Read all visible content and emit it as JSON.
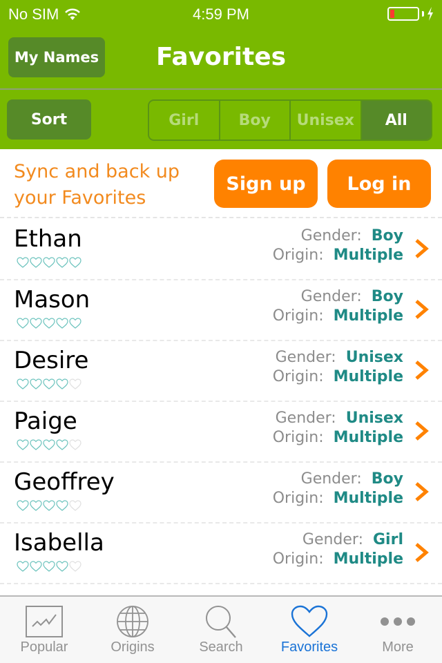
{
  "status_bar": {
    "carrier": "No SIM",
    "time": "4:59 PM",
    "battery_level": 0.1,
    "charging": true
  },
  "nav": {
    "title": "Favorites",
    "my_names_label": "My Names"
  },
  "filter": {
    "sort_label": "Sort",
    "segments": [
      {
        "label": "Girl",
        "active": false
      },
      {
        "label": "Boy",
        "active": false
      },
      {
        "label": "Unisex",
        "active": false
      },
      {
        "label": "All",
        "active": true
      }
    ]
  },
  "sync": {
    "line1": "Sync and back up",
    "line2": "your Favorites",
    "signup_label": "Sign up",
    "login_label": "Log in"
  },
  "labels": {
    "gender": "Gender:",
    "origin": "Origin:"
  },
  "names": [
    {
      "name": "Ethan",
      "gender": "Boy",
      "origin": "Multiple",
      "rating": 5
    },
    {
      "name": "Mason",
      "gender": "Boy",
      "origin": "Multiple",
      "rating": 5
    },
    {
      "name": "Desire",
      "gender": "Unisex",
      "origin": "Multiple",
      "rating": 4
    },
    {
      "name": "Paige",
      "gender": "Unisex",
      "origin": "Multiple",
      "rating": 4
    },
    {
      "name": "Geoffrey",
      "gender": "Boy",
      "origin": "Multiple",
      "rating": 4
    },
    {
      "name": "Isabella",
      "gender": "Girl",
      "origin": "Multiple",
      "rating": 4
    }
  ],
  "colors": {
    "brand_green": "#79b900",
    "dark_green": "#568a28",
    "orange": "#ff8200",
    "teal": "#1f8a85",
    "tab_active": "#1a73d6"
  },
  "tabs": [
    {
      "label": "Popular",
      "icon": "chart-icon",
      "active": false
    },
    {
      "label": "Origins",
      "icon": "globe-icon",
      "active": false
    },
    {
      "label": "Search",
      "icon": "search-icon",
      "active": false
    },
    {
      "label": "Favorites",
      "icon": "heart-icon",
      "active": true
    },
    {
      "label": "More",
      "icon": "more-icon",
      "active": false
    }
  ]
}
